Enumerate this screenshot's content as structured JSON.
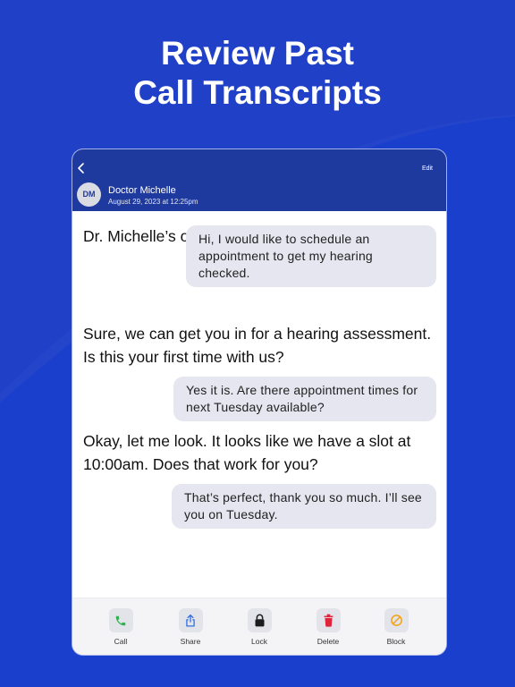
{
  "headline": {
    "line1": "Review Past",
    "line2": "Call Transcripts"
  },
  "header": {
    "edit_label": "Edit",
    "avatar_initials": "DM",
    "contact_name": "Doctor Michelle",
    "call_date": "August 29, 2023 at 12:25pm"
  },
  "transcript": {
    "messages": [
      {
        "side": "left",
        "text": "Dr. Michelle’s office."
      },
      {
        "side": "right",
        "text": "Hi, I would like to schedule an appointment to get my hearing checked."
      },
      {
        "side": "left",
        "text": "Sure, we can get you in for a hearing assessment. Is this your first time with us?"
      },
      {
        "side": "right",
        "text": "Yes it is. Are there appointment times for next Tuesday available?"
      },
      {
        "side": "left",
        "text": "Okay, let me look. It looks like we have a slot at 10:00am. Does that work for you?"
      },
      {
        "side": "right",
        "text": "That’s perfect, thank you so much. I’ll see you on Tuesday."
      }
    ]
  },
  "toolbar": {
    "items": [
      {
        "label": "Call",
        "icon": "phone-icon",
        "color": "#2fb14b"
      },
      {
        "label": "Share",
        "icon": "share-icon",
        "color": "#2f6fe0"
      },
      {
        "label": "Lock",
        "icon": "lock-icon",
        "color": "#1c1c1e"
      },
      {
        "label": "Delete",
        "icon": "trash-icon",
        "color": "#e0243c"
      },
      {
        "label": "Block",
        "icon": "block-icon",
        "color": "#f0a21b"
      }
    ]
  },
  "colors": {
    "background": "#1a3fcf",
    "header_bar": "#1f3a9e",
    "bubble": "#e5e6ef"
  }
}
